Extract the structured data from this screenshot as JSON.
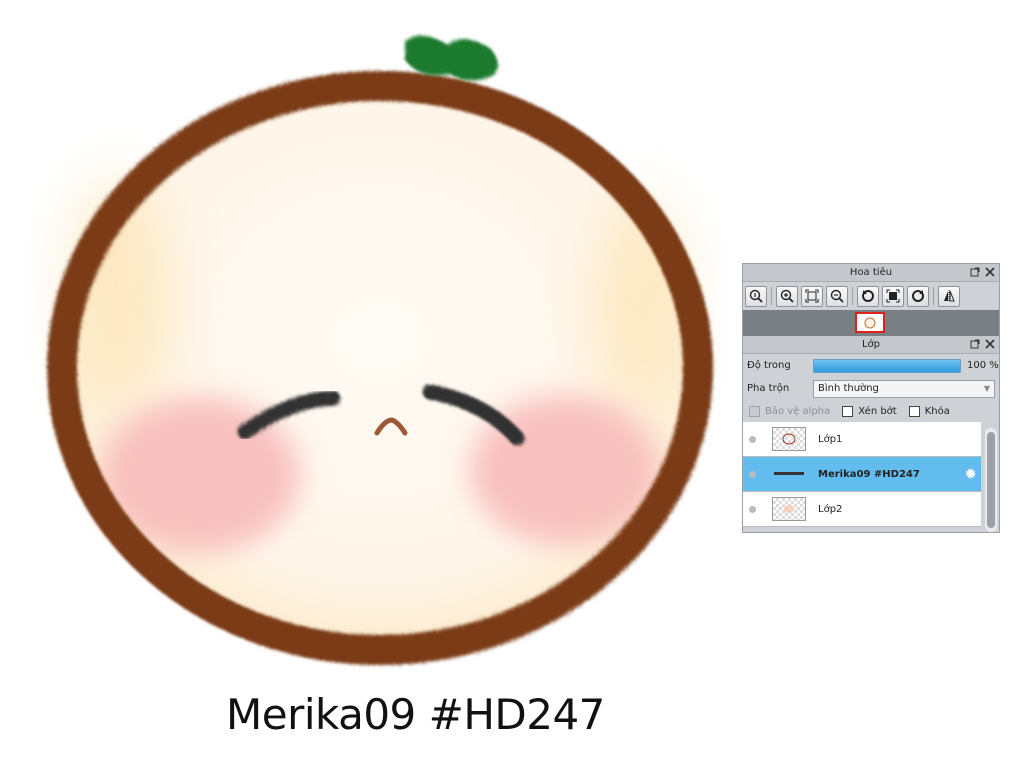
{
  "caption": "Merika09 #HD247",
  "navigator": {
    "title": "Hoa tiêu",
    "tools": [
      "actual-size-icon",
      "zoom-in-icon",
      "fit-screen-icon",
      "zoom-out-icon",
      "rotate-left-icon",
      "reset-view-icon",
      "rotate-right-icon",
      "flip-horizontal-icon"
    ]
  },
  "layer_panel": {
    "title": "Lớp",
    "opacity_label": "Độ trong",
    "opacity_value": "100 %",
    "opacity_fraction": 1.0,
    "blend_label": "Pha trộn",
    "blend_value": "Bình thường",
    "protect_alpha": "Bảo vệ alpha",
    "clipping": "Xén bớt",
    "lock": "Khóa",
    "layers": [
      {
        "name": "Lớp1",
        "selected": false
      },
      {
        "name": "Merika09 #HD247",
        "selected": true
      },
      {
        "name": "Lớp2",
        "selected": false
      }
    ]
  },
  "colors": {
    "accent": "#62bdee",
    "outline": "#7a3a17",
    "leaf": "#1f7a2f",
    "blush": "#f7b8b8"
  }
}
